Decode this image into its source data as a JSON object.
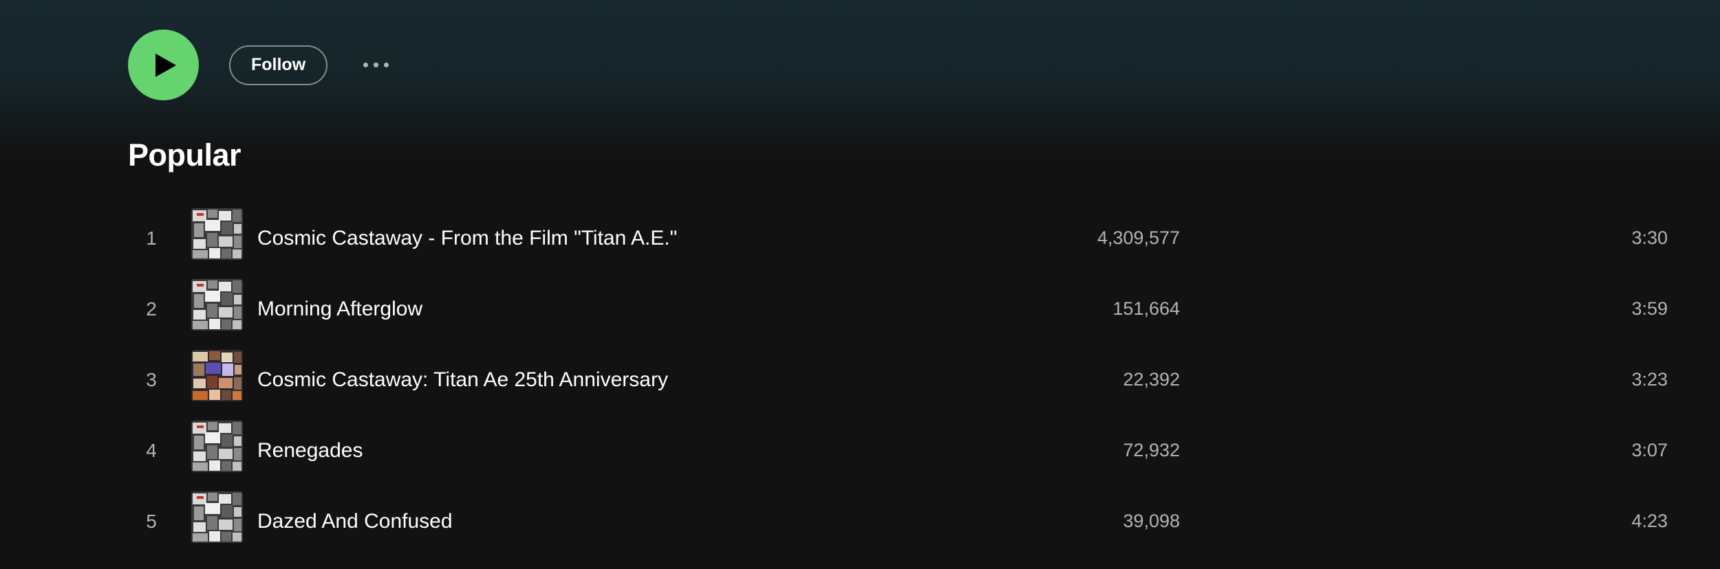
{
  "actions": {
    "play_icon": "play-icon",
    "follow_label": "Follow",
    "more_icon": "more-options-icon"
  },
  "popular": {
    "title": "Popular",
    "tracks": [
      {
        "number": "1",
        "title": "Cosmic Castaway - From the Film \"Titan A.E.\"",
        "plays": "4,309,577",
        "duration": "3:30"
      },
      {
        "number": "2",
        "title": "Morning Afterglow",
        "plays": "151,664",
        "duration": "3:59"
      },
      {
        "number": "3",
        "title": "Cosmic Castaway: Titan Ae 25th Anniversary",
        "plays": "22,392",
        "duration": "3:23"
      },
      {
        "number": "4",
        "title": "Renegades",
        "plays": "72,932",
        "duration": "3:07"
      },
      {
        "number": "5",
        "title": "Dazed And Confused",
        "plays": "39,098",
        "duration": "4:23"
      }
    ]
  },
  "colors": {
    "accent": "#65d46e",
    "background": "#121212",
    "text_primary": "#ffffff",
    "text_secondary": "#b3b3b3"
  }
}
